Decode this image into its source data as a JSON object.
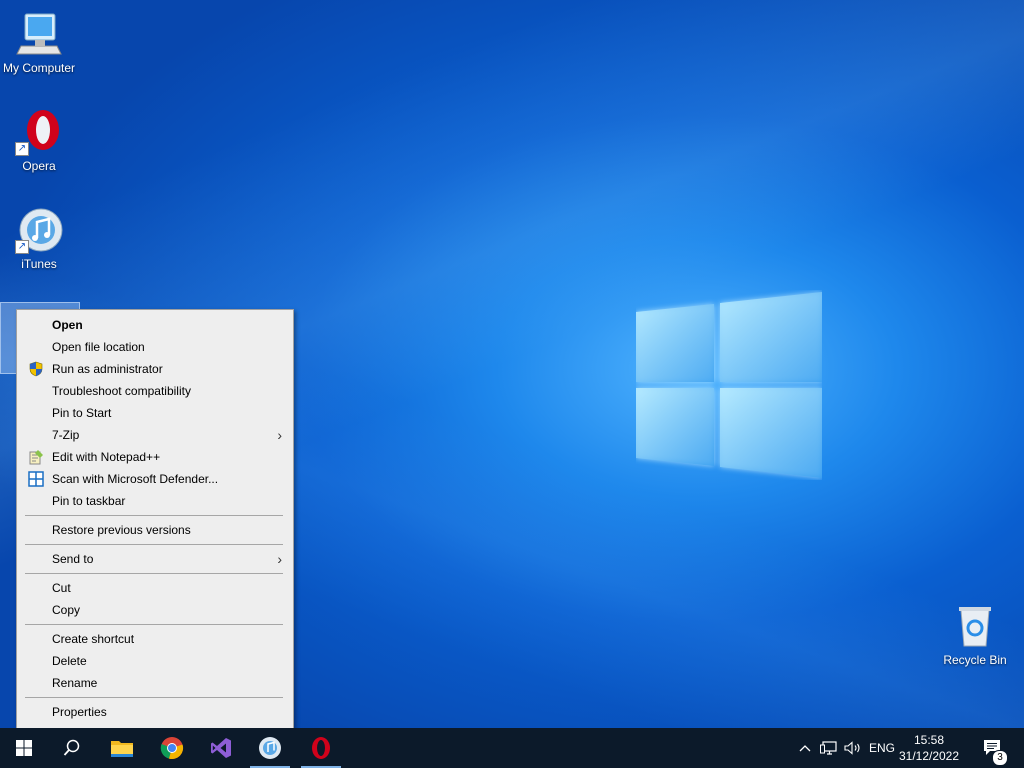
{
  "desktop": {
    "icons": [
      {
        "label": "My Computer"
      },
      {
        "label": "Opera"
      },
      {
        "label": "iTunes"
      },
      {
        "label": "Recycle Bin"
      }
    ]
  },
  "context_menu": {
    "items": [
      {
        "label": "Open"
      },
      {
        "label": "Open file location"
      },
      {
        "label": "Run as administrator"
      },
      {
        "label": "Troubleshoot compatibility"
      },
      {
        "label": "Pin to Start"
      },
      {
        "label": "7-Zip"
      },
      {
        "label": "Edit with Notepad++"
      },
      {
        "label": "Scan with Microsoft Defender..."
      },
      {
        "label": "Pin to taskbar"
      },
      {
        "label": "Restore previous versions"
      },
      {
        "label": "Send to"
      },
      {
        "label": "Cut"
      },
      {
        "label": "Copy"
      },
      {
        "label": "Create shortcut"
      },
      {
        "label": "Delete"
      },
      {
        "label": "Rename"
      },
      {
        "label": "Properties"
      }
    ]
  },
  "taskbar": {
    "apps": [
      "start-icon",
      "search-icon",
      "file-explorer-icon",
      "chrome-icon",
      "visual-studio-icon",
      "itunes-icon",
      "opera-icon"
    ],
    "tray": {
      "language": "ENG",
      "time": "15:58",
      "date": "31/12/2022",
      "notification_count": "3"
    }
  },
  "colors": {
    "taskbar_bg": "#0c1a2a",
    "menu_bg": "#eeeeee",
    "desktop_accent": "#1e88ec"
  }
}
